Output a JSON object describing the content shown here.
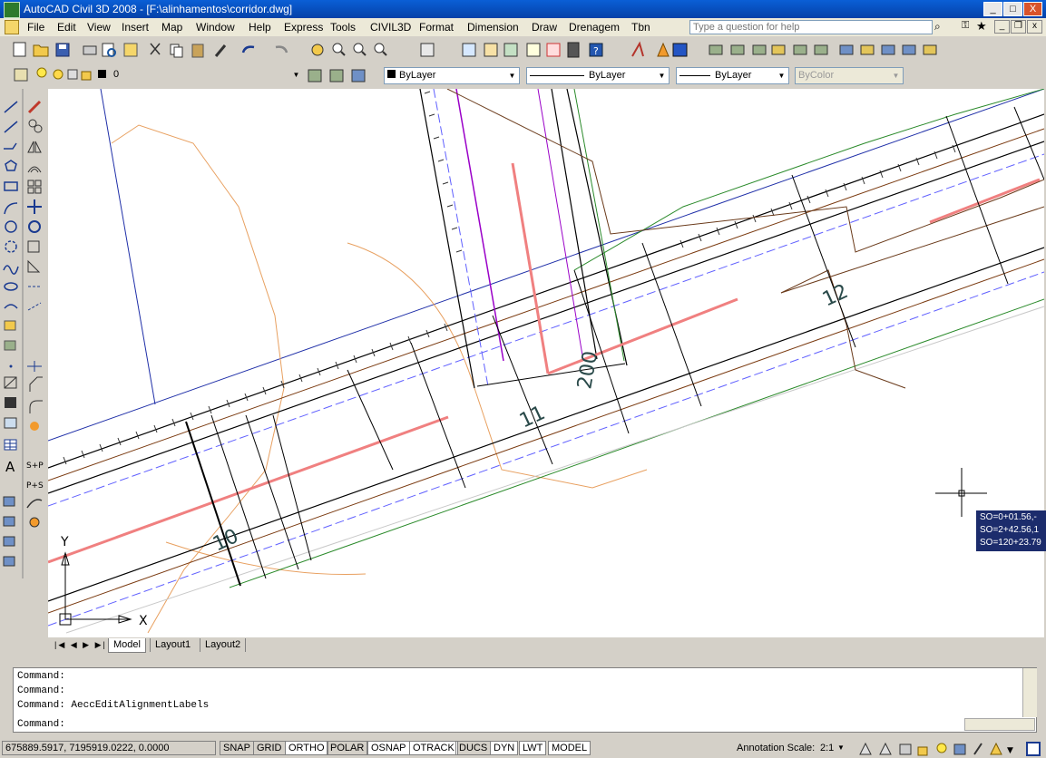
{
  "window": {
    "title": "AutoCAD Civil 3D 2008 - [F:\\alinhamentos\\corridor.dwg]",
    "minimize": "_",
    "maximize": "□",
    "close": "X"
  },
  "menu": [
    "File",
    "Edit",
    "View",
    "Insert",
    "Map",
    "Window",
    "Help",
    "Express",
    "Tools",
    "CIVIL3D",
    "Format",
    "Dimension",
    "Draw",
    "Drenagem",
    "Tbn"
  ],
  "help": {
    "placeholder": "Type a question for help"
  },
  "layer": {
    "name": "0"
  },
  "properties": {
    "color": "ByLayer",
    "linetype": "ByLayer",
    "lineweight": "ByLayer",
    "plotstyle": "ByColor"
  },
  "drawing": {
    "station_labels": [
      "10",
      "11",
      "12",
      "200"
    ],
    "ucs": {
      "x": "X",
      "y": "Y"
    },
    "tooltip": [
      "SO=0+01.56,-",
      "SO=2+42.56,1",
      "SO=120+23.79"
    ]
  },
  "tabs": [
    "Model",
    "Layout1",
    "Layout2"
  ],
  "command_lines": [
    "Command:",
    "Command:",
    "Command:  AeccEditAlignmentLabels"
  ],
  "command_prompt": "Command:",
  "status": {
    "coords": "675889.5917, 7195919.0222, 0.0000",
    "toggles": [
      "SNAP",
      "GRID",
      "ORTHO",
      "POLAR",
      "OSNAP",
      "OTRACK",
      "DUCS",
      "DYN",
      "LWT",
      "MODEL"
    ],
    "annotation_label": "Annotation Scale:",
    "annotation_value": "2:1"
  },
  "colors": {
    "accent_red": "#f08080",
    "alignment_blue": "#1f2fa8",
    "title_blue": "#0a5fd6"
  }
}
